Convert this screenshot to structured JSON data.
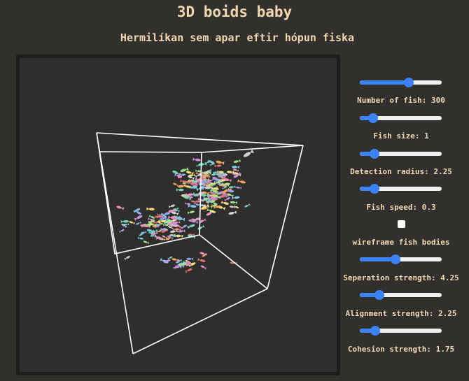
{
  "page": {
    "title": "3D boids baby",
    "subtitle": "Hermilíkan sem apar eftir hópun fiska"
  },
  "controls": {
    "fish_count": {
      "label": "Number of fish: 300",
      "value": 300,
      "fraction": 0.6
    },
    "fish_size": {
      "label": "Fish size: 1",
      "value": 1,
      "fraction": 0.16
    },
    "detection_radius": {
      "label": "Detection radius: 2.25",
      "value": 2.25,
      "fraction": 0.18
    },
    "fish_speed": {
      "label": "Fish speed: 0.3",
      "value": 0.3,
      "fraction": 0.18
    },
    "wireframe": {
      "label": "wireframe fish bodies",
      "checked": false
    },
    "separation_strength": {
      "label": "Seperation strength: 4.25",
      "value": 4.25,
      "fraction": 0.44
    },
    "alignment_strength": {
      "label": "Alignment strength: 2.25",
      "value": 2.25,
      "fraction": 0.24
    },
    "cohesion_strength": {
      "label": "Cohesion strength: 1.75",
      "value": 1.75,
      "fraction": 0.19
    }
  },
  "colors": {
    "slider_accent": "#3b82f6",
    "text": "#f0d8b4",
    "background": "#31302d",
    "canvas_background": "#2e2e2c",
    "wireframe_box": "#ffffff",
    "fish_palette": [
      "#e07070",
      "#7ec8e3",
      "#f5e07a",
      "#a3e28a",
      "#d08be0",
      "#f5a65b",
      "#8fa8f0",
      "#f08fc4",
      "#cfcfcf",
      "#6fd6b8"
    ]
  }
}
